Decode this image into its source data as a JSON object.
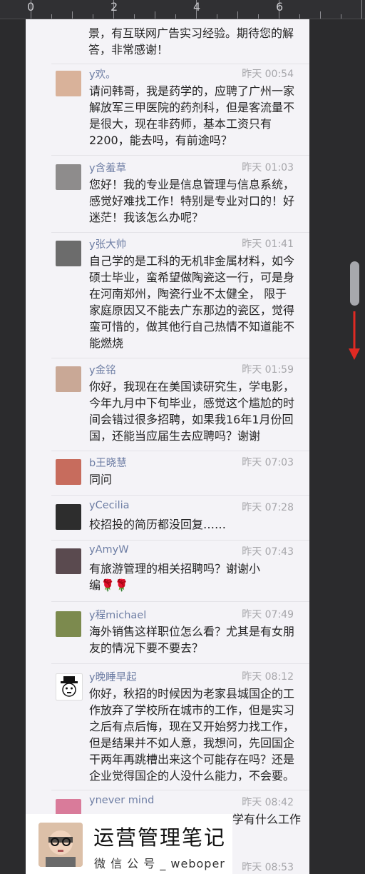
{
  "ruler": {
    "labels": [
      "0",
      "2",
      "4",
      "6"
    ]
  },
  "top_text": [
    "景，有互联网广告实习经验。期待您的解",
    "答，非常感谢！"
  ],
  "comments": [
    {
      "name": "y欢。",
      "time": "昨天 00:54",
      "lines": [
        "请问韩哥，我是药学的，应聘了广州一家",
        "解放军三甲医院的药剂科，但是客流量不",
        "是很大，现在非药师，基本工资只有",
        "2200，能去吗，有前途吗？"
      ]
    },
    {
      "name": "y含羞草",
      "time": "昨天 01:03",
      "lines": [
        "您好！我的专业是信息管理与信息系统，",
        "感觉好难找工作！特别是专业对口的！好",
        "迷茫！我该怎么办呢？"
      ]
    },
    {
      "name": "y张大帅",
      "time": "昨天 01:41",
      "lines": [
        "自己学的是工科的无机非金属材料，如今",
        "硕士毕业，蛮希望做陶瓷这一行，可是身",
        "在河南郑州，陶瓷行业不太健全， 限于",
        "家庭原因又不能去广东那边的瓷区，觉得",
        "蛮可惜的，做其他行自己热情不知道能不",
        "能燃烧"
      ]
    },
    {
      "name": "y金铭",
      "time": "昨天 01:59",
      "lines": [
        "你好，我现在在美国读研究生，学电影，",
        "今年九月中下旬毕业，感觉这个尴尬的时",
        "间会错过很多招聘，如果我16年1月份回",
        "国，还能当应届生去应聘吗？谢谢"
      ]
    },
    {
      "name": "b王晓慧",
      "time": "昨天 07:03",
      "lines": [
        "同问"
      ]
    },
    {
      "name": "yCecilia",
      "time": "昨天 07:28",
      "lines": [
        "校招投的简历都没回复……"
      ]
    },
    {
      "name": "yAmyW",
      "time": "昨天 07:43",
      "lines": [
        "有旅游管理的相关招聘吗？谢谢小",
        "编🌹🌹"
      ]
    },
    {
      "name": "y程michael",
      "time": "昨天 07:49",
      "lines": [
        "海外销售这样职位怎么看？尤其是有女朋",
        "友的情况下要不要去？"
      ]
    },
    {
      "name": "y晚睡早起",
      "time": "昨天 08:12",
      "lines": [
        "你好，秋招的时候因为老家县城国企的工",
        "作放弃了学校所在城市的工作，但是实习",
        "之后有点后悔，现在又开始努力找工作，",
        "但是结果并不如人意，我想问，先回国企",
        "干两年再跳槽出来这个可能存在吗？还是",
        "企业觉得国企的人没什么能力，不会要。"
      ]
    },
    {
      "name": "ynever  mind",
      "time": "昨天 08:42",
      "lines": [
        "学有什么工作"
      ]
    },
    {
      "name": "",
      "time": "昨天 08:53",
      "lines": []
    }
  ],
  "brand": {
    "title": "运营管理笔记",
    "subtitle": "微 信 公 号 _  weboper"
  },
  "colors": {
    "arrow": "#e02a23",
    "name": "#6e7ea4",
    "time": "#a6a6aa"
  }
}
